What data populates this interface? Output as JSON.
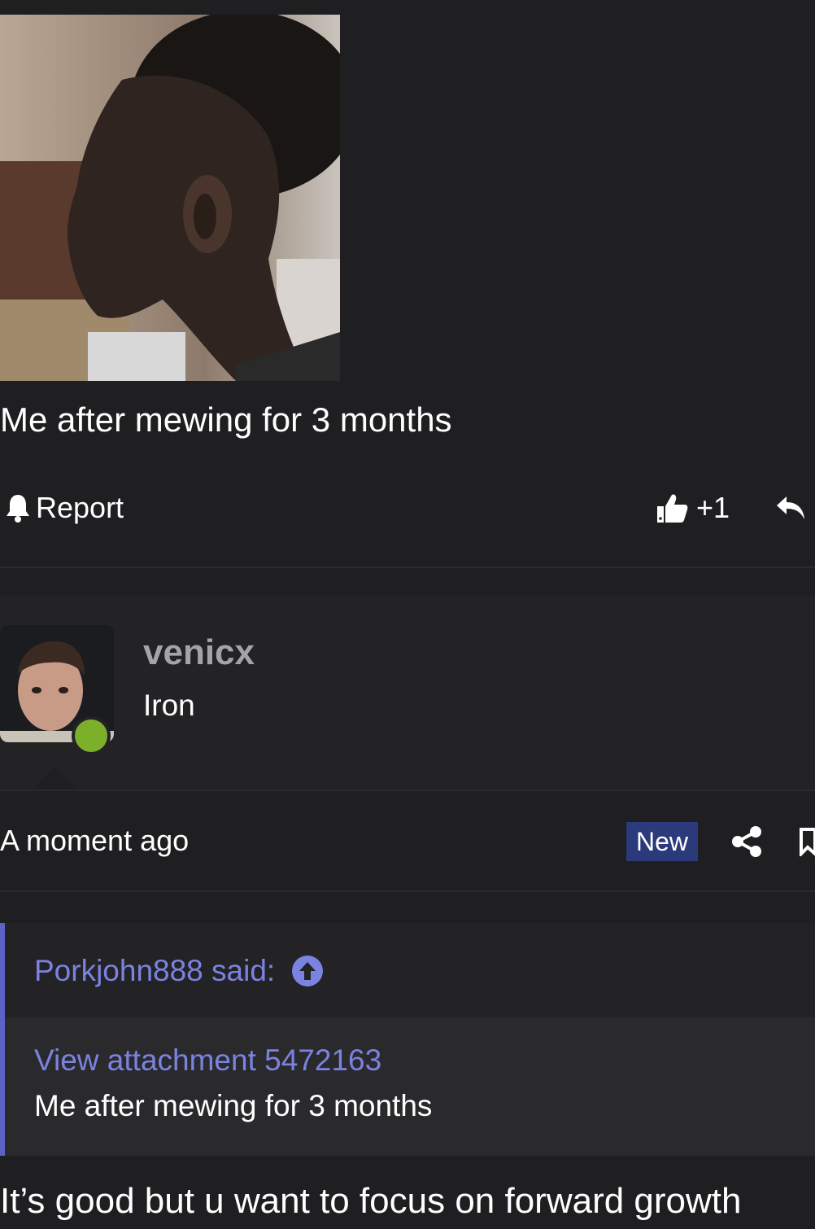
{
  "post": {
    "image_alt": "photo of a person in side profile",
    "caption": "Me after mewing for 3 months",
    "actions": {
      "report_label": "Report",
      "report_icon": "bell-icon",
      "like_count": "+1",
      "like_icon": "thumbs-up-icon",
      "reply_icon": "reply-arrow-icon"
    }
  },
  "reply_post": {
    "username": "venicx",
    "user_title": "Iron",
    "online": true,
    "timestamp": "A moment ago",
    "new_badge": "New",
    "share_icon": "share-icon",
    "bookmark_icon": "bookmark-icon",
    "quote": {
      "author_line": "Porkjohn888 said:",
      "jump_icon": "arrow-up-circle-icon",
      "attachment_link": "View attachment 5472163",
      "text": "Me after mewing for 3 months"
    },
    "body": "It’s good but u want to focus on forward growth"
  },
  "colors": {
    "background": "#1f1f21",
    "panel": "#232325",
    "link": "#7b83e0",
    "quote_border": "#5c63c4",
    "badge": "#2b3a7a",
    "online": "#7cb02a"
  }
}
